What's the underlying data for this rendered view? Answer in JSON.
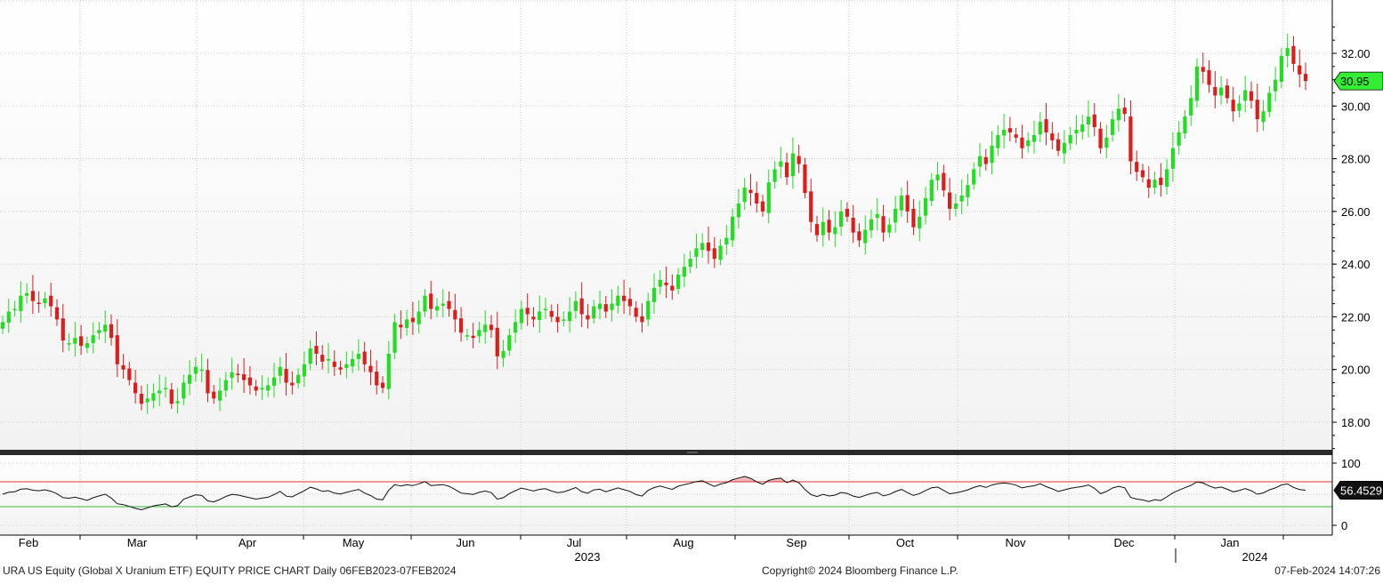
{
  "footer": {
    "left": "URA US Equity (Global X Uranium ETF) EQUITY PRICE CHART  Daily 06FEB2023-07FEB2024",
    "center": "Copyright© 2024 Bloomberg Finance L.P.",
    "right": "07-Feb-2024 14:07:26"
  },
  "colors": {
    "up": "#22dd22",
    "down": "#dd1c1c",
    "grid": "#cccccc",
    "overbought": "#dd3333",
    "oversold": "#33bb33",
    "last_price_badge": "#33ee33"
  },
  "chart_data": [
    {
      "type": "candlestick",
      "title": "",
      "ylim": [
        17,
        34
      ],
      "ytick_labels": [
        "18.00",
        "20.00",
        "22.00",
        "24.00",
        "26.00",
        "28.00",
        "30.00",
        "32.00"
      ],
      "ytick_values": [
        18,
        20,
        22,
        24,
        26,
        28,
        30,
        32
      ],
      "grid": true,
      "last_price_label": "30.95",
      "last_price": 30.95,
      "x_axis": {
        "months": [
          "Feb",
          "Mar",
          "Apr",
          "May",
          "Jun",
          "Jul",
          "Aug",
          "Sep",
          "Oct",
          "Nov",
          "Dec",
          "Jan"
        ],
        "years": [
          "2023",
          "2024"
        ],
        "date_range": [
          "2023-02-06",
          "2024-02-07"
        ]
      },
      "close": [
        21.8,
        22.2,
        22.3,
        22.8,
        22.9,
        22.6,
        22.5,
        22.7,
        22.4,
        21.9,
        21.1,
        21.0,
        21.2,
        20.9,
        21.0,
        21.3,
        21.5,
        21.7,
        21.2,
        20.2,
        20.0,
        19.6,
        19.1,
        18.7,
        18.9,
        19.1,
        19.2,
        19.3,
        18.7,
        18.8,
        19.5,
        19.8,
        20.1,
        20.0,
        19.1,
        18.9,
        19.2,
        19.6,
        19.9,
        19.8,
        19.6,
        19.4,
        19.2,
        19.3,
        19.4,
        19.7,
        20.1,
        19.5,
        19.4,
        19.8,
        20.2,
        20.8,
        20.6,
        20.3,
        20.4,
        20.1,
        20.0,
        20.2,
        20.4,
        20.6,
        20.2,
        19.9,
        19.4,
        19.3,
        20.6,
        21.8,
        21.6,
        21.9,
        21.8,
        22.2,
        22.8,
        22.3,
        22.4,
        22.5,
        22.3,
        21.9,
        21.4,
        21.3,
        21.2,
        21.5,
        21.7,
        21.5,
        20.5,
        20.7,
        21.3,
        21.8,
        22.3,
        22.1,
        21.9,
        22.2,
        22.3,
        22.0,
        21.8,
        21.9,
        22.2,
        22.6,
        22.1,
        21.9,
        22.4,
        22.5,
        22.2,
        22.5,
        22.8,
        22.6,
        22.4,
        22.0,
        21.8,
        22.6,
        23.1,
        23.4,
        23.2,
        23.0,
        23.6,
        23.9,
        24.2,
        24.6,
        24.8,
        24.5,
        24.2,
        24.7,
        25.0,
        25.8,
        26.3,
        26.9,
        26.7,
        26.3,
        26.0,
        27.1,
        27.6,
        27.9,
        27.3,
        28.2,
        27.8,
        26.7,
        25.6,
        25.1,
        25.6,
        25.2,
        25.4,
        26.0,
        25.8,
        25.2,
        24.9,
        25.3,
        25.7,
        25.9,
        25.2,
        25.5,
        26.1,
        26.6,
        26.0,
        25.4,
        25.8,
        26.5,
        27.2,
        27.4,
        26.8,
        26.1,
        26.3,
        26.6,
        27.0,
        27.6,
        28.1,
        27.8,
        28.5,
        28.9,
        29.1,
        29.0,
        28.8,
        28.4,
        28.7,
        28.9,
        29.4,
        29.0,
        28.7,
        28.3,
        28.6,
        28.9,
        29.1,
        29.3,
        29.6,
        29.2,
        28.4,
        28.8,
        29.5,
        29.9,
        29.7,
        27.9,
        27.5,
        27.3,
        26.9,
        27.2,
        27.0,
        27.6,
        28.4,
        29.0,
        29.6,
        30.3,
        31.5,
        31.3,
        30.8,
        30.4,
        30.7,
        30.3,
        29.8,
        30.1,
        30.6,
        30.2,
        29.5,
        29.8,
        30.5,
        31.0,
        31.9,
        32.2,
        31.6,
        31.2,
        30.95
      ]
    },
    {
      "type": "line",
      "title": "",
      "ylim": [
        0,
        100
      ],
      "ytick_labels": [
        "100",
        "0"
      ],
      "ytick_values": [
        100,
        0
      ],
      "overbought_level": 70,
      "oversold_level": 30,
      "last_value_label": "56.4529",
      "last_value": 56.4529
    }
  ]
}
